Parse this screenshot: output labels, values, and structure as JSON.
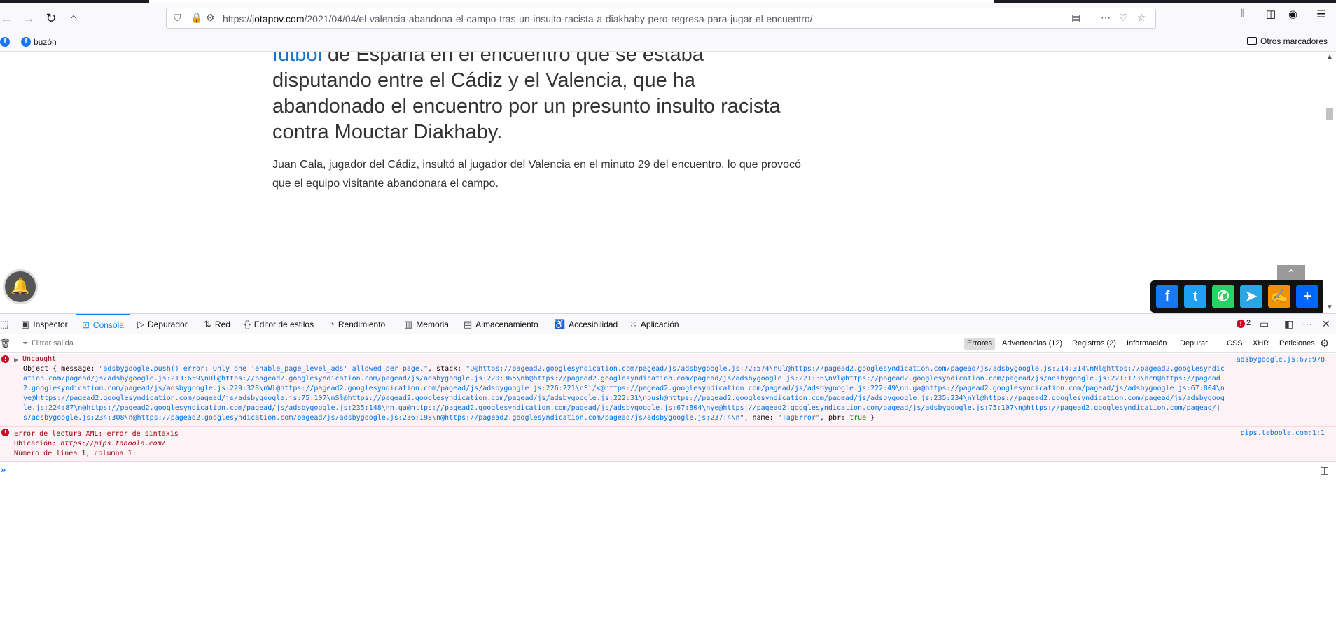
{
  "browser": {
    "url_prefix": "https://",
    "url_host": "jotapov.com",
    "url_path": "/2021/04/04/el-valencia-abandona-el-campo-tras-un-insulto-racista-a-diakhaby-pero-regresa-para-jugar-el-encuentro/",
    "bookmarks": {
      "buzon": "buzón",
      "otros": "Otros marcadores"
    }
  },
  "article": {
    "lead_link": "fútbol",
    "lead_text": " de España en el encuentro que se estaba disputando entre el Cádiz y el Valencia, que ha abandonado el encuentro por un presunto insulto racista contra Mouctar Diakhaby.",
    "body": "Juan Cala, jugador del Cádiz, insultó al jugador del Valencia en el minuto 29 del encuentro, lo que provocó que el equipo visitante abandonara el campo."
  },
  "devtools": {
    "tabs": {
      "inspector": "Inspector",
      "consola": "Consola",
      "depurador": "Depurador",
      "red": "Red",
      "editor": "Editor de estilos",
      "rendimiento": "Rendimiento",
      "memoria": "Memoria",
      "almacenamiento": "Almacenamiento",
      "accesibilidad": "Accesibilidad",
      "aplicacion": "Aplicación"
    },
    "error_count": "2",
    "filter_placeholder": "Filtrar salida",
    "filters": {
      "errores": "Errores",
      "advertencias": "Advertencias (12)",
      "registros": "Registros (2)",
      "informacion": "Información",
      "depurar": "Depurar",
      "css": "CSS",
      "xhr": "XHR",
      "peticiones": "Peticiones"
    },
    "messages": [
      {
        "title": "Uncaught",
        "source": "adsbygoogle.js:67:978",
        "object_start": "Object { message: ",
        "message": "\"adsbygoogle.push() error: Only one 'enable_page_level_ads' allowed per page.\"",
        "stack_label": ", stack: ",
        "stack": "\"Q@https://pagead2.googlesyndication.com/pagead/js/adsbygoogle.js:72:574\\nOl@https://pagead2.googlesyndication.com/pagead/js/adsbygoogle.js:214:314\\nNl@https://pagead2.googlesyndication.com/pagead/js/adsbygoogle.js:213:659\\nUl@https://pagead2.googlesyndication.com/pagead/js/adsbygoogle.js:220:365\\nb@https://pagead2.googlesyndication.com/pagead/js/adsbygoogle.js:221:36\\nVl@https://pagead2.googlesyndication.com/pagead/js/adsbygoogle.js:221:173\\ncm@https://pagead2.googlesyndication.com/pagead/js/adsbygoogle.js:229:328\\nWl@https://pagead2.googlesyndication.com/pagead/js/adsbygoogle.js:226:221\\nSl/<@https://pagead2.googlesyndication.com/pagead/js/adsbygoogle.js:222:49\\nn.ga@https://pagead2.googlesyndication.com/pagead/js/adsbygoogle.js:67:804\\nye@https://pagead2.googlesyndication.com/pagead/js/adsbygoogle.js:75:107\\nSl@https://pagead2.googlesyndication.com/pagead/js/adsbygoogle.js:222:31\\npush@https://pagead2.googlesyndication.com/pagead/js/adsbygoogle.js:235:234\\nYl@https://pagead2.googlesyndication.com/pagead/js/adsbygoogle.js:224:87\\n@https://pagead2.googlesyndication.com/pagead/js/adsbygoogle.js:235:148\\nn.ga@https://pagead2.googlesyndication.com/pagead/js/adsbygoogle.js:67:804\\nye@https://pagead2.googlesyndication.com/pagead/js/adsbygoogle.js:75:107\\n@https://pagead2.googlesyndication.com/pagead/js/adsbygoogle.js:234:308\\n@https://pagead2.googlesyndication.com/pagead/js/adsbygoogle.js:236:198\\n@https://pagead2.googlesyndication.com/pagead/js/adsbygoogle.js:237:4\\n\"",
        "name_label": ", name: ",
        "name": "\"TagError\"",
        "pbr_label": ", pbr: ",
        "pbr": "true",
        "object_end": " }"
      },
      {
        "line1": "Error de lectura XML: error de sintaxis",
        "line2_label": "Ubicación: ",
        "line2_value": "https://pips.taboola.com/",
        "line3": "Número de línea 1, columna 1:",
        "source": "pips.taboola.com:1:1"
      }
    ]
  }
}
